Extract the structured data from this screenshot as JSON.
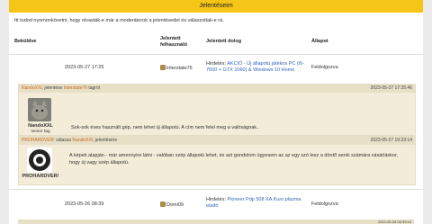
{
  "header": {
    "title": "Jelentéseim"
  },
  "intro": "Itt tudod nyomonkövetni, hogy olvasták-e már a moderátorok a jelentésedet és válaszoltak-e rá.",
  "table": {
    "headers": [
      "Beküldve",
      "Jelentett felhasználó",
      "Jelentett dolog",
      "Állapot"
    ]
  },
  "rows": [
    {
      "date": "2023-05-27 17:25",
      "user": "interstate76",
      "thing_prefix": "Hirdetés:",
      "thing_link": "AKCIÓ - Új állapotú játékos PC (i5-7500 + GTX 1060) & Windows 10 Home",
      "status": "Feldolgozva"
    },
    {
      "date": "2023-05-26 08:39",
      "user": "Domi09",
      "thing_prefix": "Hirdetés:",
      "thing_link": "Pioneer Pdp 508 XA Kuro plazma eladó",
      "status": "Feldolgozva"
    }
  ],
  "messages": [
    {
      "author": "NandoXXL",
      "action_pre": "jelentése",
      "target": "interstate76",
      "action_post": "tagról",
      "timestamp": "2023-05-27 17:25:46",
      "name": "NandoXXL",
      "rank": "senior tag",
      "text": "Sok-sok éves használt gép, nem lehet új állapotú. A cím nem felel meg a valóságnak.."
    },
    {
      "author": "PROHARDVER!",
      "action_pre": "válasza",
      "target": "NandoXXL",
      "action_post": "jelentésére",
      "timestamp": "2023-05-27 19:23:14",
      "name": "PROHARDVER!",
      "rank": "",
      "text": "A képek alapján - már amennyire látni - valóban szép állapotú lehet, és azt gondolom úgyesem az az egy szó lesz a döntő senki számára vásárláskor, hogy új vagy szép állapotú."
    }
  ],
  "partial_bar": {
    "timestamp": "2023-05-26 08:39:42"
  }
}
